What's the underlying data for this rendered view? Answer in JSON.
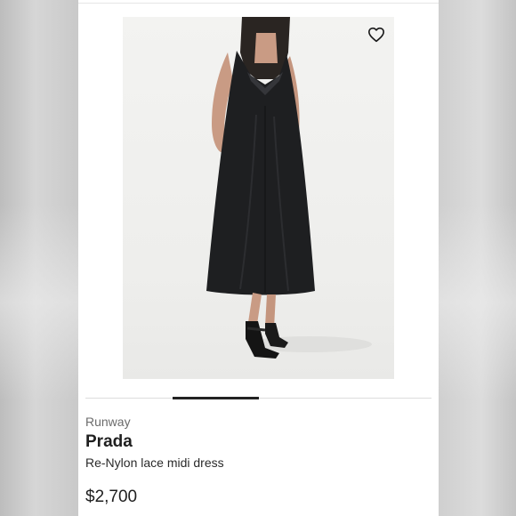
{
  "product": {
    "category": "Runway",
    "brand": "Prada",
    "name": "Re-Nylon lace midi dress",
    "price": "$2,700"
  },
  "gallery": {
    "favorite_icon": "heart-outline-icon",
    "active_slide": 2,
    "slide_count": 4
  },
  "colors": {
    "dress": "#1e1f21",
    "background": "#f1f1ef",
    "text_primary": "#1f1f1f",
    "text_muted": "#6b6b6b"
  }
}
